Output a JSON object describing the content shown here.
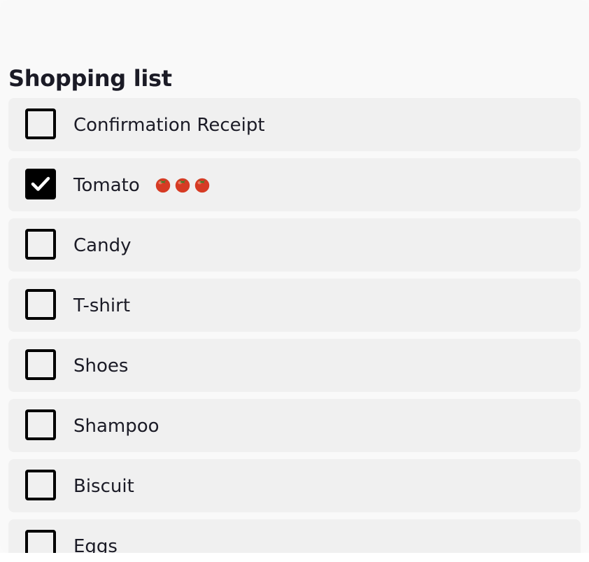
{
  "title": "Shopping list",
  "items": [
    {
      "label": "Confirmation Receipt",
      "checked": false
    },
    {
      "label": "Tomato",
      "checked": true,
      "icons": [
        "tomato-icon",
        "tomato-icon",
        "tomato-icon"
      ]
    },
    {
      "label": "Candy",
      "checked": false
    },
    {
      "label": "T-shirt",
      "checked": false
    },
    {
      "label": "Shoes",
      "checked": false
    },
    {
      "label": "Shampoo",
      "checked": false
    },
    {
      "label": "Biscuit",
      "checked": false
    },
    {
      "label": "Eggs",
      "checked": false
    }
  ],
  "colors": {
    "background": "#f9f9f9",
    "row": "#f0f0f0",
    "text": "#1b1b26",
    "checkbox": "#000000"
  }
}
